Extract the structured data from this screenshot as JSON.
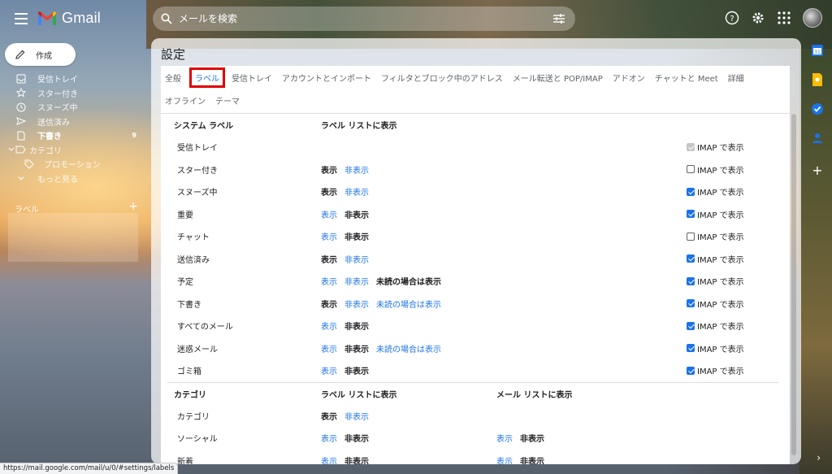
{
  "app": {
    "name": "Gmail"
  },
  "search": {
    "placeholder": "メールを検索"
  },
  "sidebar": {
    "compose_label": "作成",
    "items": [
      {
        "label": "受信トレイ",
        "icon": "inbox-icon",
        "bold": false
      },
      {
        "label": "スター付き",
        "icon": "star-icon",
        "bold": false
      },
      {
        "label": "スヌーズ中",
        "icon": "clock-icon",
        "bold": false
      },
      {
        "label": "送信済み",
        "icon": "send-icon",
        "bold": false
      },
      {
        "label": "下書き",
        "icon": "draft-icon",
        "bold": true,
        "count": "9"
      },
      {
        "label": "カテゴリ",
        "icon": "label-icon",
        "bold": false
      },
      {
        "label": "プロモーション",
        "icon": "tag-icon",
        "bold": false
      },
      {
        "label": "もっと見る",
        "icon": "chevron-down-icon",
        "bold": false
      }
    ],
    "labels_heading": "ラベル",
    "labels_add": "+"
  },
  "settings": {
    "title": "設定",
    "tabs_row1": [
      "全般",
      "ラベル",
      "受信トレイ",
      "アカウントとインポート",
      "フィルタとブロック中のアドレス",
      "メール転送と POP/IMAP",
      "アドオン",
      "チャットと Meet",
      "詳細"
    ],
    "tabs_row2": [
      "オフライン",
      "テーマ"
    ],
    "active_tab": "ラベル",
    "system_header": {
      "name": "システム ラベル",
      "label_col": "ラベル リストに表示"
    },
    "system_rows": [
      {
        "name": "受信トレイ",
        "imap": "IMAP で表示"
      },
      {
        "name": "スター付き",
        "show": "表示",
        "hide": "非表示",
        "imap": "IMAP で表示"
      },
      {
        "name": "スヌーズ中",
        "show": "表示",
        "hide": "非表示",
        "imap": "IMAP で表示"
      },
      {
        "name": "重要",
        "show": "表示",
        "hide": "非表示",
        "imap": "IMAP で表示"
      },
      {
        "name": "チャット",
        "show": "表示",
        "hide": "非表示",
        "imap": "IMAP で表示"
      },
      {
        "name": "送信済み",
        "show": "表示",
        "hide": "非表示",
        "imap": "IMAP で表示"
      },
      {
        "name": "予定",
        "show": "表示",
        "hide": "非表示",
        "unread": "未読の場合は表示",
        "imap": "IMAP で表示"
      },
      {
        "name": "下書き",
        "show": "表示",
        "hide": "非表示",
        "unread": "未読の場合は表示",
        "imap": "IMAP で表示"
      },
      {
        "name": "すべてのメール",
        "show": "表示",
        "hide": "非表示",
        "imap": "IMAP で表示"
      },
      {
        "name": "迷惑メール",
        "show": "表示",
        "hide": "非表示",
        "unread": "未読の場合は表示",
        "imap": "IMAP で表示"
      },
      {
        "name": "ゴミ箱",
        "show": "表示",
        "hide": "非表示",
        "imap": "IMAP で表示"
      }
    ],
    "category_header": {
      "name": "カテゴリ",
      "label_col": "ラベル リストに表示",
      "mail_col": "メール リストに表示"
    },
    "category_rows": [
      {
        "name": "カテゴリ",
        "show": "表示",
        "hide": "非表示"
      },
      {
        "name": "ソーシャル",
        "show": "表示",
        "hide": "非表示",
        "mail_show": "表示",
        "mail_hide": "非表示"
      },
      {
        "name": "新着",
        "show": "表示",
        "hide": "非表示",
        "mail_show": "表示",
        "mail_hide": "非表示"
      }
    ]
  },
  "status_url": "https://mail.google.com/mail/u/0/#settings/labels",
  "colors": {
    "accent": "#1a73e8",
    "highlight": "#e00000"
  }
}
